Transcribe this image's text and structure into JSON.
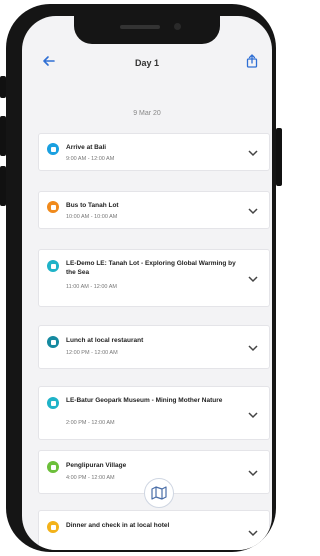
{
  "header": {
    "title": "Day 1"
  },
  "date": "9 Mar 20",
  "colors": {
    "accent": "#2f6fd4",
    "blue": "#1aa0e0",
    "orange": "#f08a1c",
    "teal": "#1fb3c8",
    "dark_teal": "#158aa0",
    "green": "#6cbf3a",
    "yellow": "#f3b21a"
  },
  "items": [
    {
      "title": "Arrive at Bali",
      "time": "9:00 AM - 12:00 AM",
      "icon": "plane-icon"
    },
    {
      "title": "Bus to Tanah Lot",
      "time": "10:00 AM - 10:00 AM",
      "icon": "bus-icon"
    },
    {
      "title": "LE-Demo LE: Tanah Lot - Exploring Global Warming by the Sea",
      "time": "11:00 AM - 12:00 AM",
      "icon": "activity-icon"
    },
    {
      "title": "Lunch at local restaurant",
      "time": "12:00 PM - 12:00 AM",
      "icon": "restaurant-icon"
    },
    {
      "title": "LE-Batur Geopark Museum - Mining Mother Nature",
      "time": "2:00 PM - 12:00 AM",
      "icon": "activity-icon"
    },
    {
      "title": "Penglipuran Village",
      "time": "4:00 PM - 12:00 AM",
      "icon": "village-icon"
    },
    {
      "title": "Dinner and check in at local hotel",
      "time": "",
      "icon": "hotel-icon"
    }
  ]
}
